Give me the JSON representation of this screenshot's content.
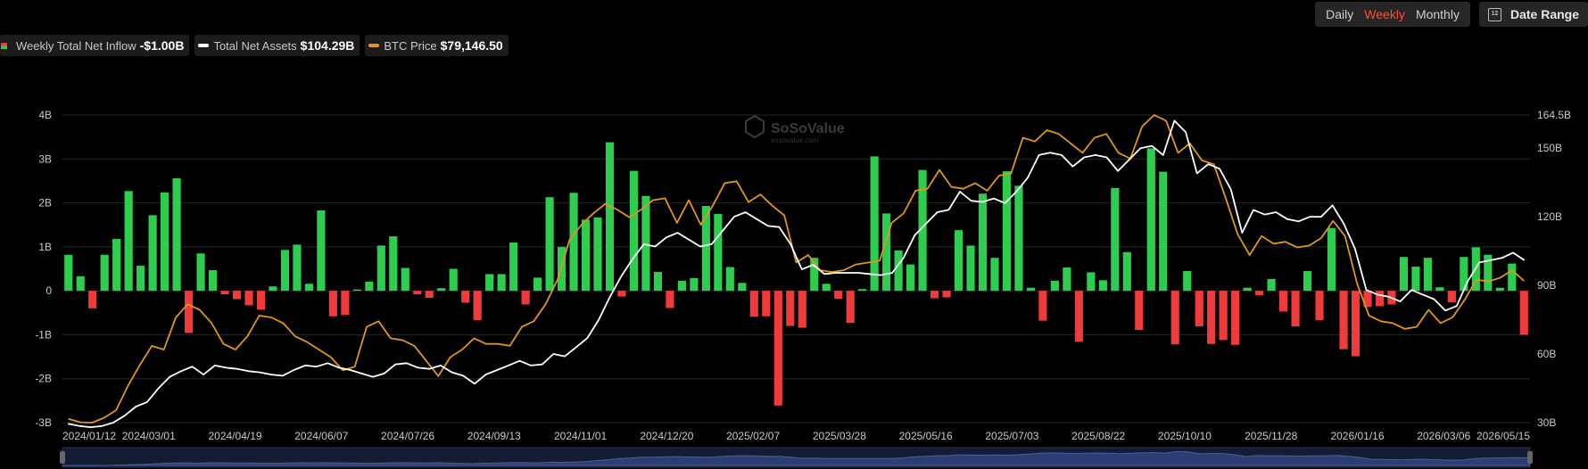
{
  "legend": {
    "inflow_label": "Weekly Total Net Inflow",
    "inflow_value": "-$1.00B",
    "assets_label": "Total Net Assets",
    "assets_value": "$104.29B",
    "btc_label": "BTC Price",
    "btc_value": "$79,146.50"
  },
  "controls": {
    "daily": "Daily",
    "weekly": "Weekly",
    "monthly": "Monthly",
    "active": "Weekly",
    "date_range": "Date Range",
    "calendar_glyph": "12"
  },
  "watermark": {
    "brand": "SoSoValue",
    "sub": "sosovalue.com"
  },
  "colors": {
    "positive": "#2ecc4f",
    "negative": "#ef3b3b",
    "assets_line": "#ffffff",
    "btc_line": "#e0961e",
    "accent": "#ff4d2e"
  },
  "chart_data": {
    "type": "bar+line",
    "x_tick_labels": [
      "2024/01/12",
      "2024/03/01",
      "2024/04/19",
      "2024/06/07",
      "2024/07/26",
      "2024/09/13",
      "2024/11/01",
      "2024/12/20",
      "2025/02/07",
      "2025/03/28",
      "2025/05/16",
      "2025/07/03",
      "2025/08/22",
      "2025/10/10",
      "2025/11/28",
      "2026/01/16",
      "2026/03/06",
      "2026/05/15"
    ],
    "y_left": {
      "ticks": [
        -3,
        -2,
        -1,
        0,
        1,
        2,
        3,
        4
      ],
      "tick_labels": [
        "-3B",
        "-2B",
        "-1B",
        "0",
        "1B",
        "2B",
        "3B",
        "4B"
      ],
      "range": [
        -3,
        4
      ],
      "unit": "B"
    },
    "y_right": {
      "ticks": [
        30,
        60,
        90,
        120,
        150,
        164.5
      ],
      "tick_labels": [
        "30B",
        "60B",
        "90B",
        "120B",
        "150B",
        "164.5B"
      ],
      "range": [
        30,
        164.5
      ]
    },
    "grid": true,
    "series": [
      {
        "name": "Weekly Total Net Inflow",
        "type": "bar",
        "axis": "left",
        "unit": "B USD",
        "values": [
          0.82,
          0.33,
          -0.4,
          0.82,
          1.18,
          2.27,
          0.57,
          1.72,
          2.24,
          2.56,
          -0.96,
          0.85,
          0.47,
          -0.08,
          -0.19,
          -0.33,
          -0.43,
          0.1,
          0.93,
          1.05,
          0.16,
          1.83,
          -0.58,
          -0.55,
          0.03,
          0.21,
          1.03,
          1.24,
          0.52,
          -0.08,
          -0.16,
          0.06,
          0.5,
          -0.27,
          -0.67,
          0.38,
          0.38,
          1.1,
          -0.31,
          0.3,
          2.13,
          1.0,
          2.23,
          1.62,
          1.67,
          3.38,
          -0.13,
          2.73,
          2.16,
          0.43,
          -0.39,
          0.23,
          0.29,
          1.93,
          1.75,
          0.54,
          0.18,
          -0.59,
          -0.58,
          -2.61,
          -0.8,
          -0.84,
          0.75,
          0.16,
          -0.18,
          -0.73,
          0.04,
          3.06,
          1.76,
          0.92,
          0.6,
          2.75,
          -0.17,
          -0.15,
          1.38,
          1.03,
          2.21,
          0.75,
          2.72,
          2.39,
          0.07,
          -0.68,
          0.23,
          0.53,
          -1.16,
          0.42,
          0.24,
          2.34,
          0.88,
          -0.89,
          3.24,
          2.71,
          -1.22,
          0.45,
          -0.81,
          -1.21,
          -1.12,
          -1.23,
          0.07,
          -0.1,
          0.27,
          -0.47,
          -0.81,
          0.45,
          -0.67,
          1.43,
          -1.33,
          -1.49,
          -0.37,
          -0.35,
          -0.31,
          0.77,
          0.55,
          0.75,
          0.08,
          -0.26,
          0.77,
          0.99,
          0.82,
          0.07,
          0.62,
          -1.0
        ]
      },
      {
        "name": "Total Net Assets",
        "type": "line",
        "axis": "right",
        "unit": "B USD",
        "values": [
          29.5,
          28.5,
          28.0,
          28.5,
          30.0,
          33.0,
          37.0,
          39.0,
          45.0,
          50.0,
          52.5,
          54.5,
          51.0,
          55.0,
          54.0,
          53.5,
          52.5,
          52.0,
          51.0,
          50.5,
          53.0,
          55.0,
          54.5,
          56.0,
          54.0,
          53.0,
          51.5,
          50.0,
          51.5,
          55.5,
          56.0,
          54.0,
          53.5,
          55.0,
          52.0,
          50.5,
          47.0,
          51.0,
          53.0,
          55.0,
          57.0,
          55.0,
          55.5,
          60.0,
          59.0,
          63.0,
          67.0,
          75.0,
          85.0,
          94.0,
          101.5,
          108.0,
          107.0,
          111.0,
          113.0,
          110.0,
          107.0,
          108.0,
          114.0,
          120.0,
          122.0,
          119.0,
          116.0,
          115.5,
          108.0,
          97.0,
          99.0,
          95.0,
          95.5,
          95.5,
          95.5,
          95.0,
          94.5,
          95.5,
          102.0,
          112.0,
          117.0,
          122.0,
          123.0,
          131.0,
          127.0,
          126.5,
          128.0,
          126.0,
          131.0,
          137.0,
          147.0,
          148.0,
          147.0,
          142.0,
          146.0,
          147.0,
          146.0,
          140.0,
          145.0,
          150.0,
          151.0,
          147.0,
          162.0,
          157.0,
          139.0,
          143.0,
          141.0,
          132.0,
          113.0,
          123.0,
          121.0,
          122.0,
          119.0,
          118.0,
          120.0,
          120.0,
          125.0,
          117.0,
          106.0,
          88.0,
          86.0,
          85.0,
          83.0,
          88.0,
          86.0,
          84.0,
          79.0,
          81.0,
          92.0,
          100.0,
          101.0,
          102.0,
          104.29,
          101.0
        ]
      },
      {
        "name": "BTC Price",
        "type": "line",
        "axis": "right",
        "unit": "USD",
        "values": [
          42700,
          41800,
          41700,
          43000,
          45000,
          51500,
          57000,
          62000,
          61000,
          69500,
          73000,
          71500,
          68000,
          62500,
          61000,
          64500,
          70000,
          69500,
          68000,
          64500,
          63000,
          61000,
          59000,
          55500,
          56500,
          67000,
          68500,
          64000,
          63500,
          62000,
          58000,
          54000,
          59000,
          61000,
          64000,
          62500,
          62500,
          62000,
          67000,
          68500,
          73000,
          79500,
          90000,
          94000,
          97000,
          99500,
          98000,
          96000,
          98000,
          100500,
          101000,
          94500,
          100500,
          94000,
          99000,
          105000,
          105500,
          100000,
          102000,
          99000,
          96500,
          84000,
          86000,
          82000,
          81500,
          82000,
          83500,
          84000,
          84500,
          94500,
          97000,
          103000,
          103500,
          108500,
          104000,
          103500,
          105000,
          103000,
          107000,
          107500,
          117000,
          116000,
          119000,
          118000,
          115500,
          113000,
          117000,
          118000,
          113000,
          111500,
          120000,
          123000,
          121500,
          113000,
          115500,
          111000,
          110000,
          101000,
          91500,
          86000,
          91000,
          89000,
          89500,
          88000,
          88500,
          90500,
          95000,
          91000,
          78500,
          70000,
          68500,
          68000,
          66500,
          67000,
          71500,
          68000,
          69500,
          74000,
          79500,
          79000,
          80000,
          82000,
          79146.5
        ]
      }
    ]
  }
}
